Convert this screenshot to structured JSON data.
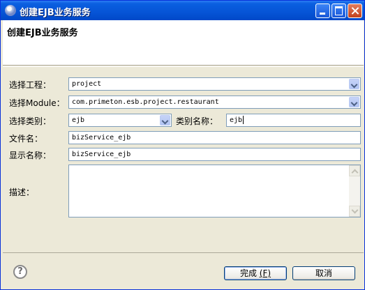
{
  "window": {
    "title": "创建EJB业务服务"
  },
  "header": {
    "title": "创建EJB业务服务"
  },
  "form": {
    "project_label": "选择工程：",
    "project_value": "project",
    "module_label": "选择Module：",
    "module_value": "com.primeton.esb.project.restaurant",
    "category_label": "选择类别：",
    "category_value": "ejb",
    "category_name_label": "类别名称：",
    "category_name_value": "ejb",
    "filename_label": "文件名：",
    "filename_value": "bizService_ejb",
    "display_name_label": "显示名称：",
    "display_name_value": "bizService_ejb",
    "description_label": "描述：",
    "description_value": ""
  },
  "footer": {
    "help_glyph": "?",
    "finish_label": "完成",
    "finish_mnemonic": "(F)",
    "cancel_label": "取消"
  },
  "colors": {
    "titlebar": "#0654d6",
    "background": "#ece9d8",
    "field_border": "#7f9db9",
    "button_border": "#003c74"
  }
}
